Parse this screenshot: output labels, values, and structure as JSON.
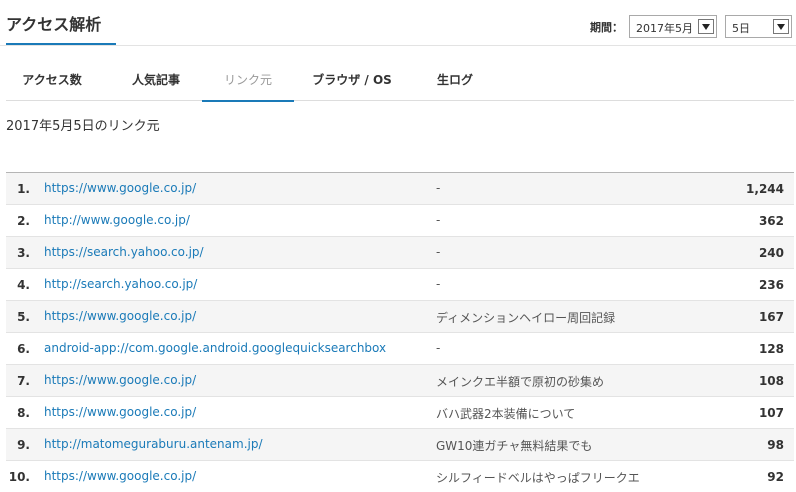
{
  "header": {
    "title": "アクセス解析",
    "period_label": "期間：",
    "month_value": "2017年5月",
    "day_value": "5日"
  },
  "tabs": [
    {
      "label": "アクセス数",
      "active": false
    },
    {
      "label": "人気記事",
      "active": false
    },
    {
      "label": "リンク元",
      "active": true
    },
    {
      "label": "ブラウザ / OS",
      "active": false
    },
    {
      "label": "生ログ",
      "active": false
    }
  ],
  "subheading": "2017年5月5日のリンク元",
  "rows": [
    {
      "rank": "1.",
      "url": "https://www.google.co.jp/",
      "keyword": "-",
      "count": "1,244"
    },
    {
      "rank": "2.",
      "url": "http://www.google.co.jp/",
      "keyword": "-",
      "count": "362"
    },
    {
      "rank": "3.",
      "url": "https://search.yahoo.co.jp/",
      "keyword": "-",
      "count": "240"
    },
    {
      "rank": "4.",
      "url": "http://search.yahoo.co.jp/",
      "keyword": "-",
      "count": "236"
    },
    {
      "rank": "5.",
      "url": "https://www.google.co.jp/",
      "keyword": "ディメンションヘイロー周回記録",
      "count": "167"
    },
    {
      "rank": "6.",
      "url": "android-app://com.google.android.googlequicksearchbox",
      "keyword": "-",
      "count": "128"
    },
    {
      "rank": "7.",
      "url": "https://www.google.co.jp/",
      "keyword": "メインクエ半額で原初の砂集め",
      "count": "108"
    },
    {
      "rank": "8.",
      "url": "https://www.google.co.jp/",
      "keyword": "バハ武器2本装備について",
      "count": "107"
    },
    {
      "rank": "9.",
      "url": "http://matomeguraburu.antenam.jp/",
      "keyword": "GW10連ガチャ無料結果でも",
      "count": "98"
    },
    {
      "rank": "10.",
      "url": "https://www.google.co.jp/",
      "keyword": "シルフィードベルはやっぱフリークエ",
      "count": "92"
    }
  ],
  "colors": {
    "accent": "#1a7ab8",
    "row_alt": "#f5f5f5"
  }
}
